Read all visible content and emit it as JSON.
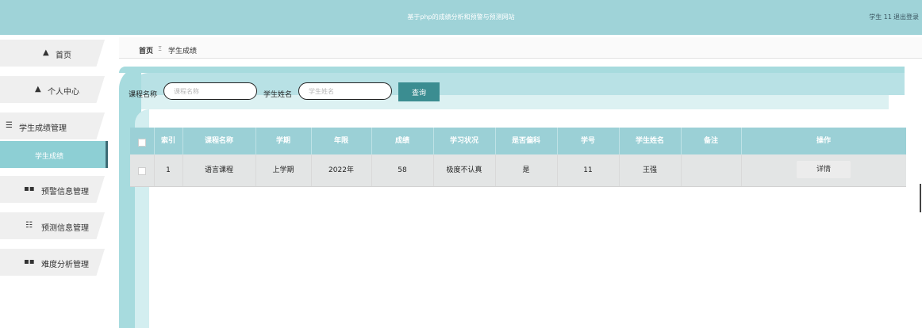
{
  "header": {
    "title": "基于php的成绩分析和预警与预测网站",
    "user": "学生 11",
    "logout": "退出登录"
  },
  "sidebar": {
    "items": [
      {
        "icon": "home-icon",
        "glyph": "▲",
        "label": "首页"
      },
      {
        "icon": "user-icon",
        "glyph": "▲",
        "label": "个人中心"
      },
      {
        "icon": "list-icon",
        "glyph": "☰",
        "label": "学生成绩管理"
      },
      {
        "label": "学生成绩"
      },
      {
        "icon": "grid-icon",
        "glyph": "▪▪",
        "label": "预警信息管理"
      },
      {
        "icon": "sliders-icon",
        "glyph": "☷",
        "label": "预测信息管理"
      },
      {
        "icon": "grid-icon",
        "glyph": "▪▪",
        "label": "难度分析管理"
      }
    ]
  },
  "breadcrumb": {
    "home": "首页",
    "sep": "Ξ",
    "current": "学生成绩"
  },
  "search": {
    "course_label": "课程名称",
    "course_placeholder": "课程名称",
    "student_label": "学生姓名",
    "student_placeholder": "学生姓名",
    "button": "查询"
  },
  "table": {
    "headers": [
      "索引",
      "课程名称",
      "学期",
      "年限",
      "成绩",
      "学习状况",
      "是否偏科",
      "学号",
      "学生姓名",
      "备注",
      "操作"
    ],
    "rows": [
      {
        "index": "1",
        "course": "语言课程",
        "term": "上学期",
        "year": "2022年",
        "score": "58",
        "status": "极度不认真",
        "bias": "是",
        "student_no": "11",
        "name": "王强",
        "note": "",
        "action": "详情"
      }
    ]
  },
  "colors": {
    "topbar": "#9fd3d8",
    "active_menu": "#8dcfd4",
    "button": "#3b8d91",
    "table_header": "#9bd0d6"
  }
}
